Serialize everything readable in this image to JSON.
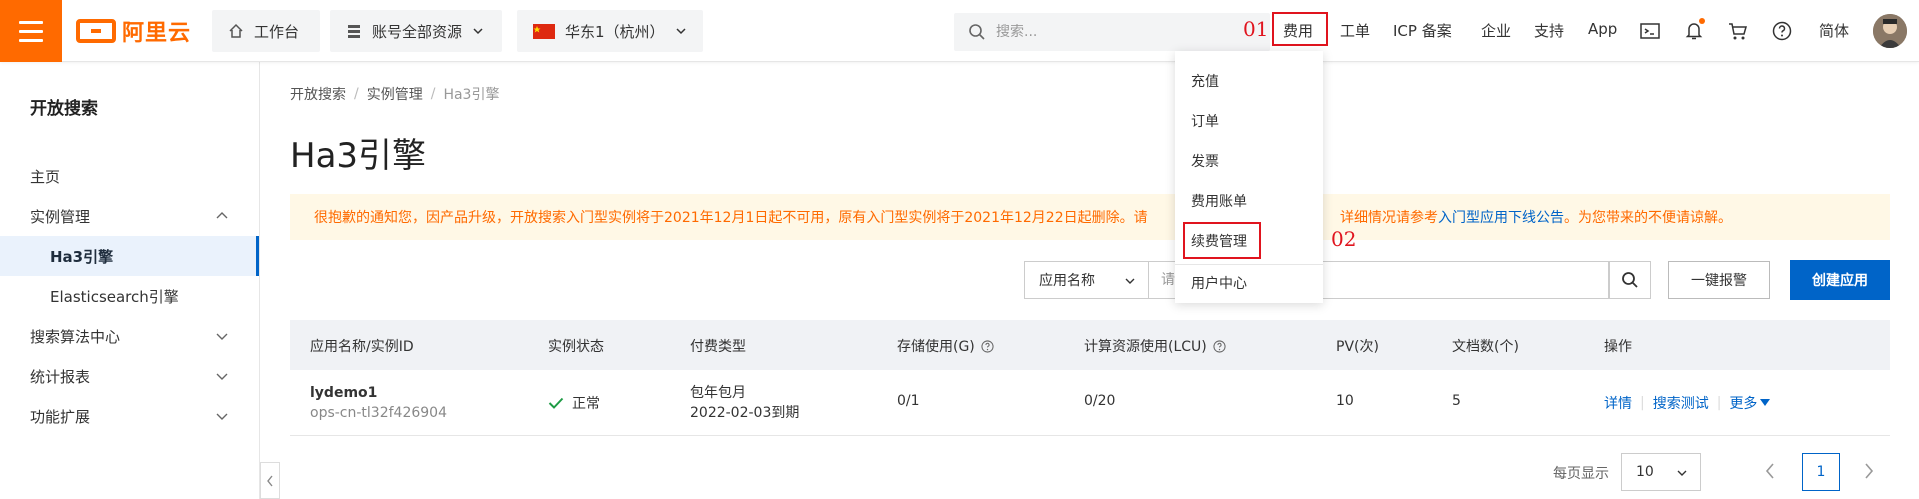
{
  "topbar": {
    "logo_text": "阿里云",
    "workbench": "工作台",
    "resources": "账号全部资源",
    "region": "华东1（杭州）",
    "search_placeholder": "搜索...",
    "nav": [
      "费用",
      "工单",
      "ICP 备案",
      "企业",
      "支持",
      "App"
    ],
    "language": "简体"
  },
  "annotations": {
    "first": "01",
    "second": "02"
  },
  "sidebar": {
    "title": "开放搜索",
    "items": [
      {
        "label": "主页"
      },
      {
        "label": "实例管理"
      },
      {
        "label": "Ha3引擎"
      },
      {
        "label": "Elasticsearch引擎"
      },
      {
        "label": "搜索算法中心"
      },
      {
        "label": "统计报表"
      },
      {
        "label": "功能扩展"
      }
    ]
  },
  "breadcrumb": [
    "开放搜索",
    "实例管理",
    "Ha3引擎"
  ],
  "page_title": "Ha3引擎",
  "notice": {
    "part1": "很抱歉的通知您，因产品升级，开放搜索入门型实例将于2021年12月1日起不可用，原有入门型实例将于2021年12月22日起删除。请",
    "part2": "详细情况请参考",
    "link": "入门型应用下线公告",
    "part3": "。为您带来的不便请谅解。"
  },
  "filter": {
    "select": "应用名称",
    "input_placeholder": "请",
    "alarm_button": "一键报警",
    "create_button": "创建应用"
  },
  "table": {
    "headers": [
      "应用名称/实例ID",
      "实例状态",
      "付费类型",
      "存储使用(G)",
      "计算资源使用(LCU)",
      "PV(次)",
      "文档数(个)",
      "操作"
    ],
    "rows": [
      {
        "name": "lydemo1",
        "id": "ops-cn-tl32f426904",
        "status": "正常",
        "billing": "包年包月",
        "expire": "2022-02-03到期",
        "storage": "0/1",
        "lcu": "0/20",
        "pv": "10",
        "docs": "5",
        "actions": [
          "详情",
          "搜索测试",
          "更多"
        ]
      }
    ]
  },
  "pagination": {
    "label": "每页显示",
    "page_size": "10",
    "current_page": "1"
  },
  "dropdown": {
    "items": [
      "充值",
      "订单",
      "发票",
      "费用账单",
      "续费管理",
      "用户中心"
    ]
  }
}
